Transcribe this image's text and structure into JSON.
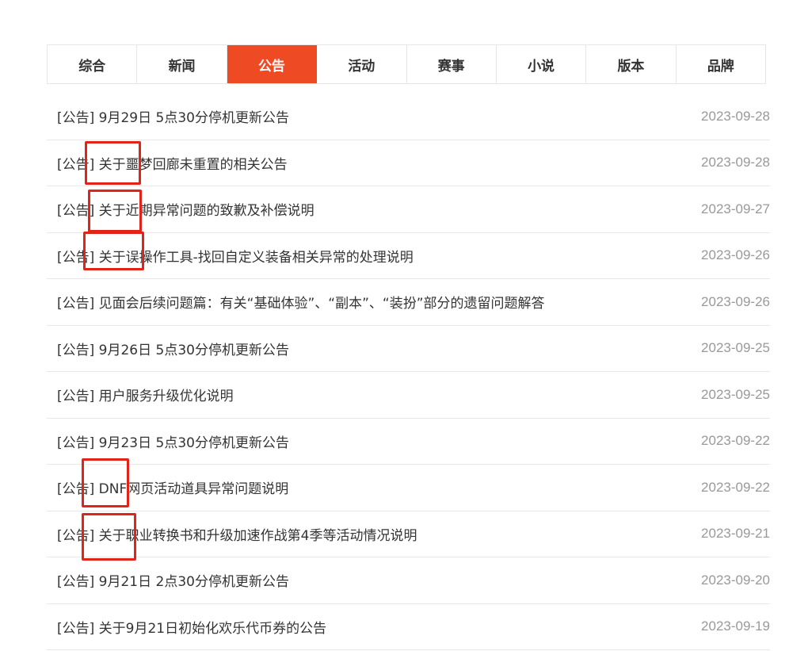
{
  "tabs": [
    {
      "label": "综合",
      "active": false
    },
    {
      "label": "新闻",
      "active": false
    },
    {
      "label": "公告",
      "active": true
    },
    {
      "label": "活动",
      "active": false
    },
    {
      "label": "赛事",
      "active": false
    },
    {
      "label": "小说",
      "active": false
    },
    {
      "label": "版本",
      "active": false
    },
    {
      "label": "品牌",
      "active": false
    }
  ],
  "news": [
    {
      "title": "[公告] 9月29日 5点30分停机更新公告",
      "date": "2023-09-28"
    },
    {
      "title": "[公告] 关于噩梦回廊未重置的相关公告",
      "date": "2023-09-28"
    },
    {
      "title": "[公告] 关于近期异常问题的致歉及补偿说明",
      "date": "2023-09-27"
    },
    {
      "title": "[公告] 关于误操作工具-找回自定义装备相关异常的处理说明",
      "date": "2023-09-26"
    },
    {
      "title": "[公告] 见面会后续问题篇：有关“基础体验”、“副本”、“装扮”部分的遗留问题解答",
      "date": "2023-09-26"
    },
    {
      "title": "[公告] 9月26日 5点30分停机更新公告",
      "date": "2023-09-25"
    },
    {
      "title": "[公告] 用户服务升级优化说明",
      "date": "2023-09-25"
    },
    {
      "title": "[公告] 9月23日 5点30分停机更新公告",
      "date": "2023-09-22"
    },
    {
      "title": "[公告] DNF网页活动道具异常问题说明",
      "date": "2023-09-22"
    },
    {
      "title": "[公告] 关于职业转换书和升级加速作战第4季等活动情况说明",
      "date": "2023-09-21"
    },
    {
      "title": "[公告] 9月21日 2点30分停机更新公告",
      "date": "2023-09-20"
    },
    {
      "title": "[公告] 关于9月21日初始化欢乐代币券的公告",
      "date": "2023-09-19"
    }
  ],
  "colors": {
    "accent": "#ee4a23",
    "highlight": "#e2231a"
  }
}
